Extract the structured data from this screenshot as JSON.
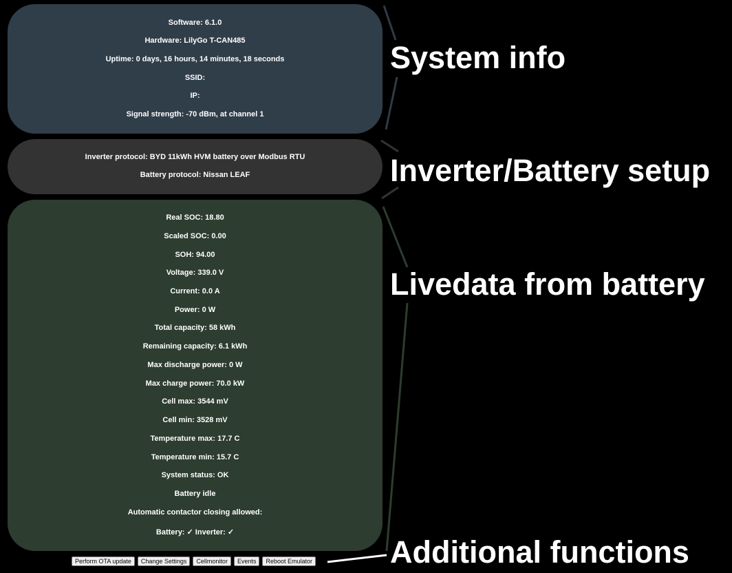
{
  "system_info": {
    "software": "Software: 6.1.0",
    "hardware": "Hardware: LilyGo T-CAN485",
    "uptime": "Uptime: 0 days, 16 hours, 14 minutes, 18 seconds",
    "ssid": "SSID:",
    "ip": "IP:",
    "signal": "Signal strength: -70 dBm, at channel 1"
  },
  "setup": {
    "inverter": "Inverter protocol: BYD 11kWh HVM battery over Modbus RTU",
    "battery": "Battery protocol: Nissan LEAF"
  },
  "livedata": {
    "real_soc": "Real SOC: 18.80",
    "scaled_soc": "Scaled SOC: 0.00",
    "soh": "SOH: 94.00",
    "voltage": "Voltage: 339.0 V",
    "current": "Current: 0.0 A",
    "power": "Power: 0 W",
    "total_capacity": "Total capacity: 58 kWh",
    "remaining_capacity": "Remaining capacity: 6.1 kWh",
    "max_discharge": "Max discharge power: 0 W",
    "max_charge": "Max charge power: 70.0 kW",
    "cell_max": "Cell max: 3544 mV",
    "cell_min": "Cell min: 3528 mV",
    "temp_max": "Temperature max: 17.7 C",
    "temp_min": "Temperature min: 15.7 C",
    "system_status": "System status: OK",
    "battery_state": "Battery idle",
    "contactor": "Automatic contactor closing allowed:",
    "contactor_status": "Battery: ✓ Inverter: ✓"
  },
  "buttons": {
    "ota": "Perform OTA update",
    "settings": "Change Settings",
    "cellmonitor": "Cellmonitor",
    "events": "Events",
    "reboot": "Reboot Emulator"
  },
  "callouts": {
    "system_info": "System info",
    "setup": "Inverter/Battery setup",
    "livedata": "Livedata from battery",
    "additional": "Additional functions"
  },
  "colors": {
    "background": "#000000",
    "system_panel": "#303e4a",
    "setup_panel": "#333333",
    "live_panel": "#2d3d2f",
    "text": "#ffffff"
  }
}
